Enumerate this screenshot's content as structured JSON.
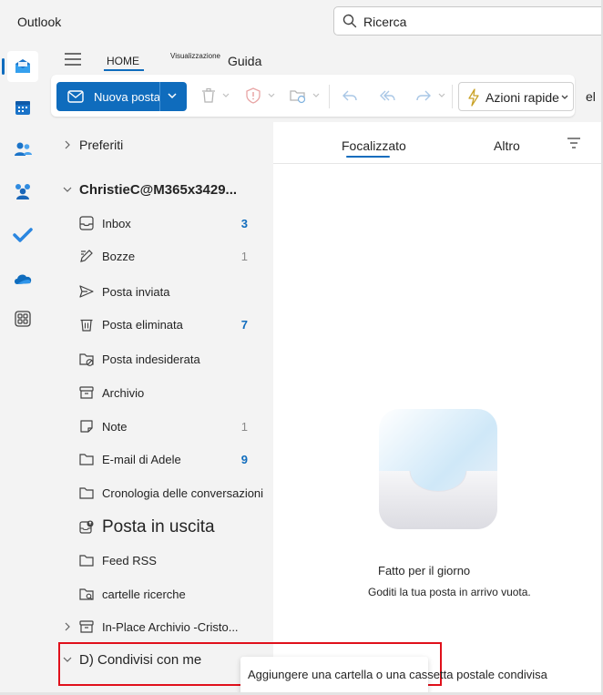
{
  "app": {
    "title": "Outlook"
  },
  "search": {
    "text": "Ricerca"
  },
  "ribbon": {
    "tabs": [
      {
        "label": "HOME"
      },
      {
        "label": "Visualizzazione"
      },
      {
        "label": "Guida"
      }
    ],
    "new_mail_label": "Nuova posta",
    "quick_steps_label": "Azioni rapide",
    "overflow_text": "el"
  },
  "folders": {
    "favorites_label": "Preferiti",
    "account_label": "ChristieC@M365x3429...",
    "items": [
      {
        "label": "Inbox",
        "count": "3",
        "count_style": "bold",
        "icon": "inbox-icon"
      },
      {
        "label": "Bozze",
        "count": "1",
        "count_style": "light",
        "icon": "drafts-icon"
      },
      {
        "label": "Posta inviata",
        "count": "",
        "count_style": "",
        "icon": "sent-icon"
      },
      {
        "label": "Posta eliminata",
        "count": "7",
        "count_style": "bold",
        "icon": "trash-icon"
      },
      {
        "label": "Posta indesiderata",
        "count": "",
        "count_style": "",
        "icon": "junk-icon"
      },
      {
        "label": "Archivio",
        "count": "",
        "count_style": "",
        "icon": "archive-icon"
      },
      {
        "label": "Note",
        "count": "1",
        "count_style": "light",
        "icon": "notes-icon"
      },
      {
        "label": "E-mail di Adele",
        "count": "9",
        "count_style": "bold",
        "icon": "folder-icon"
      },
      {
        "label": "Cronologia delle conversazioni",
        "count": "",
        "count_style": "",
        "icon": "folder-icon"
      },
      {
        "label": "Posta in uscita",
        "count": "",
        "count_style": "",
        "icon": "outbox-icon"
      },
      {
        "label": "Feed RSS",
        "count": "",
        "count_style": "",
        "icon": "folder-icon"
      },
      {
        "label": "cartelle ricerche",
        "count": "",
        "count_style": "",
        "icon": "search-folder-icon"
      }
    ],
    "in_place_archive_label": "In-Place Archivio -Cristo...",
    "shared_label": "D) Condivisi con me"
  },
  "message_list": {
    "focused_label": "Focalizzato",
    "other_label": "Altro",
    "empty_title": "Fatto per il giorno",
    "empty_subtitle": "Goditi la tua posta in arrivo vuota."
  },
  "tooltip": {
    "text": "Aggiungere una cartella o una cassetta postale condivisa"
  },
  "colors": {
    "accent": "#0f6cbd",
    "highlight": "#e0101b",
    "pane_bg": "#f3f3f3"
  }
}
